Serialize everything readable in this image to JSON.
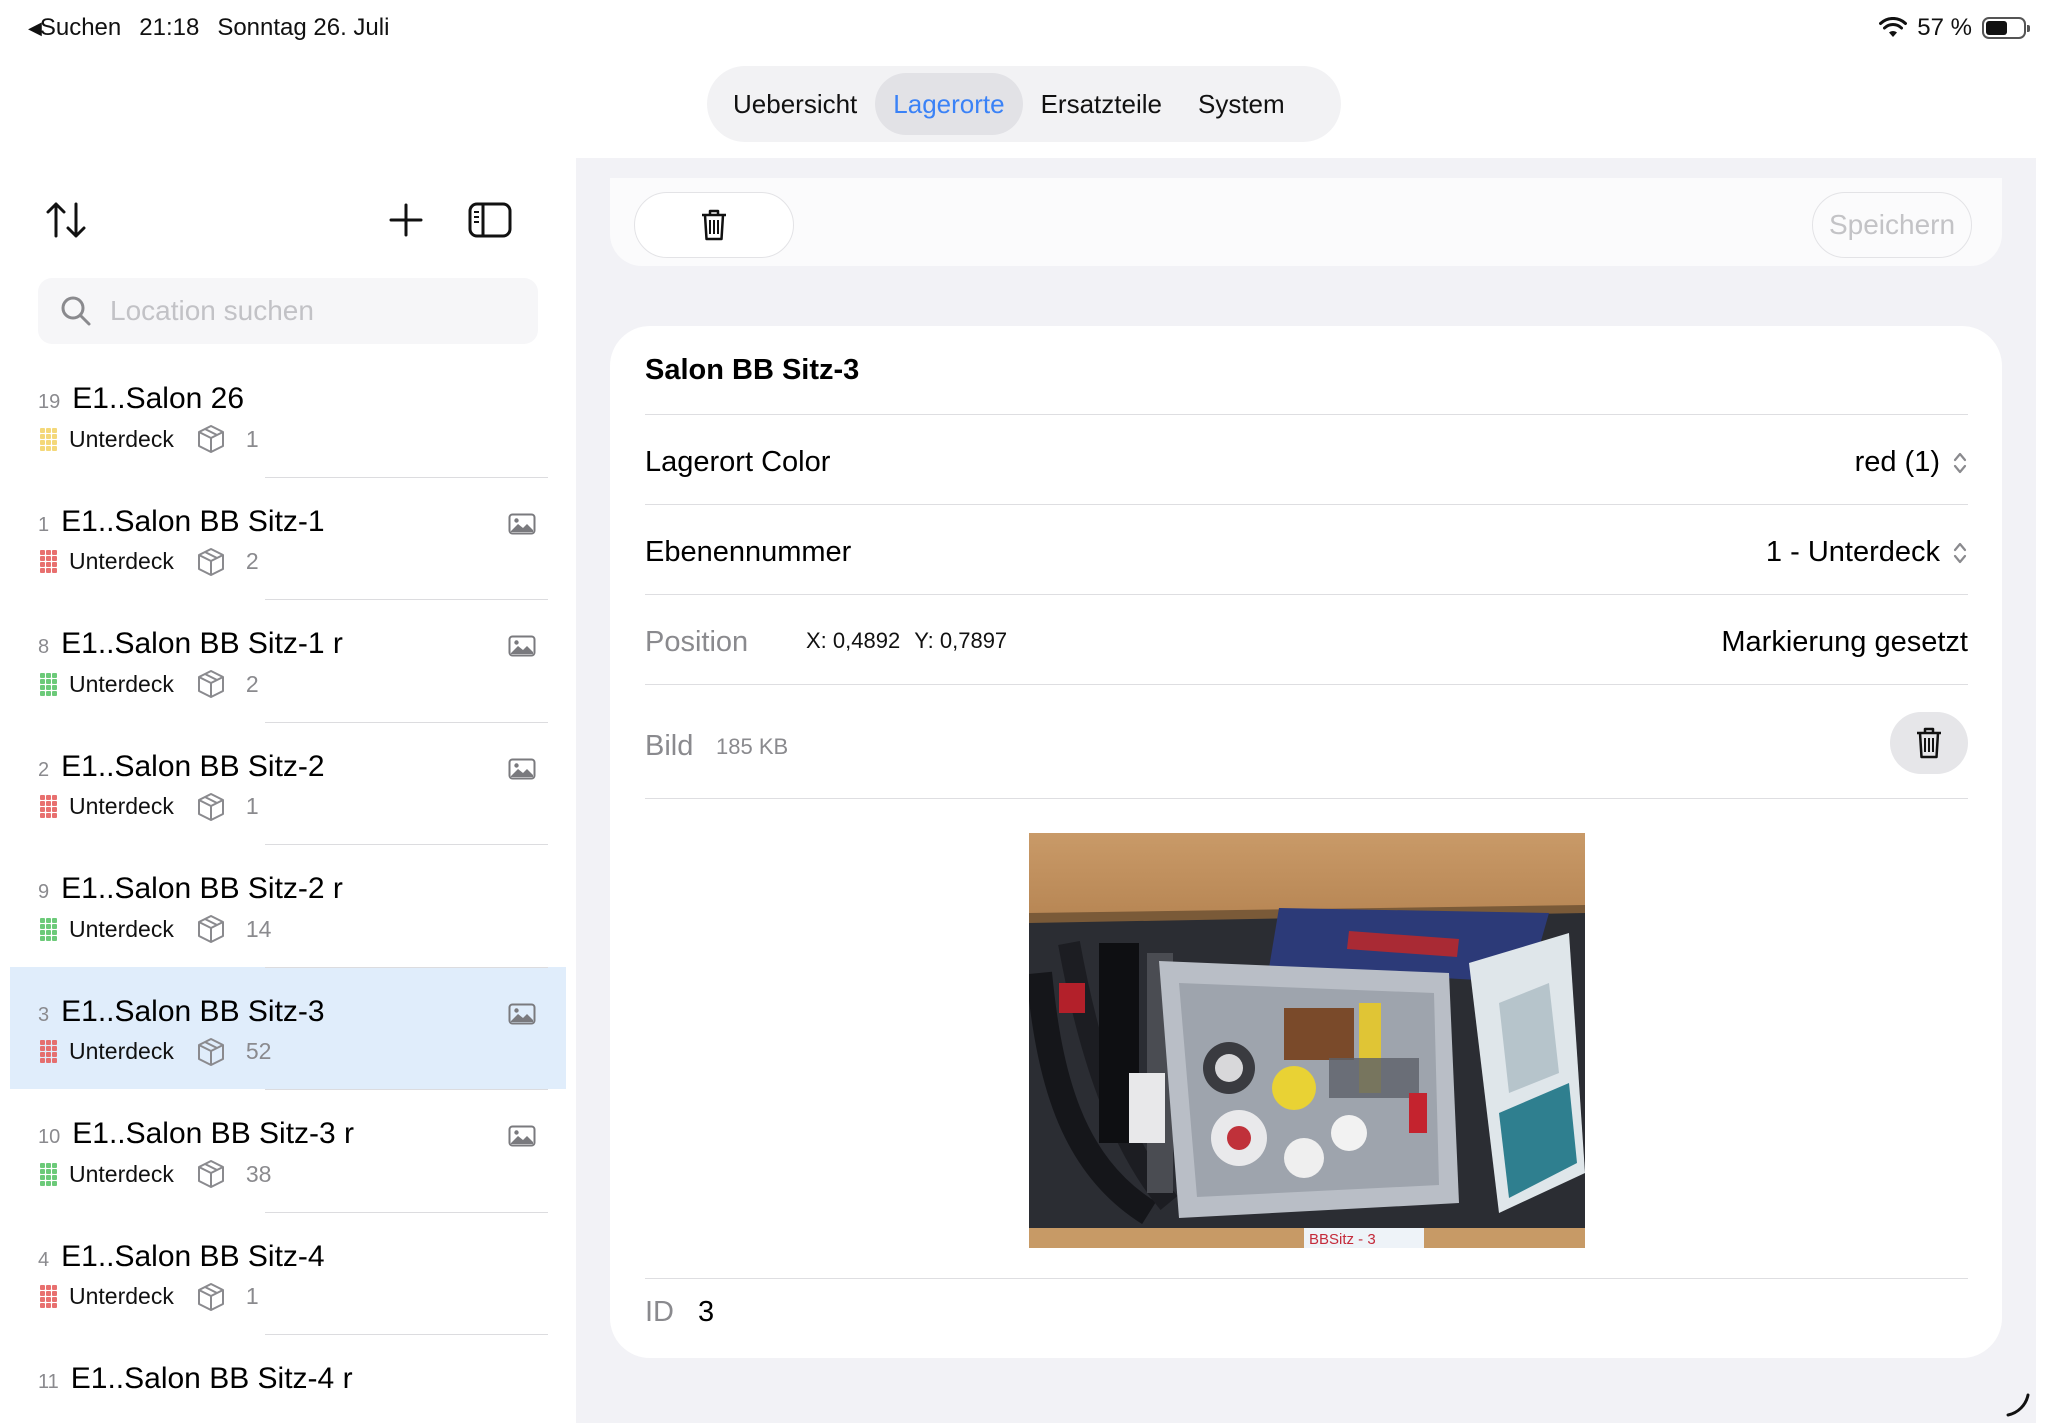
{
  "status_bar": {
    "back_label": "Suchen",
    "time": "21:18",
    "date": "Sonntag 26. Juli",
    "battery": "57 %",
    "battery_level": 0.57
  },
  "tabs": [
    {
      "label": "Uebersicht",
      "active": false
    },
    {
      "label": "Lagerorte",
      "active": true
    },
    {
      "label": "Ersatzteile",
      "active": false
    },
    {
      "label": "System",
      "active": false
    }
  ],
  "sidebar": {
    "search_placeholder": "Location suchen",
    "items": [
      {
        "num": "19",
        "name": "E1..Salon 26",
        "deck": "Unterdeck",
        "count": "1",
        "color": "#f3d46a",
        "photo": false,
        "selected": false
      },
      {
        "num": "1",
        "name": "E1..Salon BB Sitz-1",
        "deck": "Unterdeck",
        "count": "2",
        "color": "#e5605f",
        "photo": true,
        "selected": false
      },
      {
        "num": "8",
        "name": "E1..Salon BB Sitz-1 r",
        "deck": "Unterdeck",
        "count": "2",
        "color": "#5cc46a",
        "photo": true,
        "selected": false
      },
      {
        "num": "2",
        "name": "E1..Salon BB Sitz-2",
        "deck": "Unterdeck",
        "count": "1",
        "color": "#e5605f",
        "photo": true,
        "selected": false
      },
      {
        "num": "9",
        "name": "E1..Salon BB Sitz-2 r",
        "deck": "Unterdeck",
        "count": "14",
        "color": "#5cc46a",
        "photo": false,
        "selected": false
      },
      {
        "num": "3",
        "name": "E1..Salon BB Sitz-3",
        "deck": "Unterdeck",
        "count": "52",
        "color": "#e5605f",
        "photo": true,
        "selected": true
      },
      {
        "num": "10",
        "name": "E1..Salon BB Sitz-3 r",
        "deck": "Unterdeck",
        "count": "38",
        "color": "#5cc46a",
        "photo": true,
        "selected": false
      },
      {
        "num": "4",
        "name": "E1..Salon BB Sitz-4",
        "deck": "Unterdeck",
        "count": "1",
        "color": "#e5605f",
        "photo": false,
        "selected": false
      },
      {
        "num": "11",
        "name": "E1..Salon BB Sitz-4 r",
        "deck": "",
        "count": "",
        "color": "#5cc46a",
        "photo": false,
        "selected": false
      }
    ]
  },
  "detail": {
    "save_label": "Speichern",
    "title": "Salon BB Sitz-3",
    "color_label": "Lagerort Color",
    "color_value": "red (1)",
    "level_label": "Ebenennummer",
    "level_value": "1 - Unterdeck",
    "position_label": "Position",
    "position_x": "X: 0,4892",
    "position_y": "Y: 0,7897",
    "position_status": "Markierung gesetzt",
    "image_label": "Bild",
    "image_size": "185 KB",
    "photo_label": "BBSitz - 3",
    "id_label": "ID",
    "id_value": "3"
  }
}
